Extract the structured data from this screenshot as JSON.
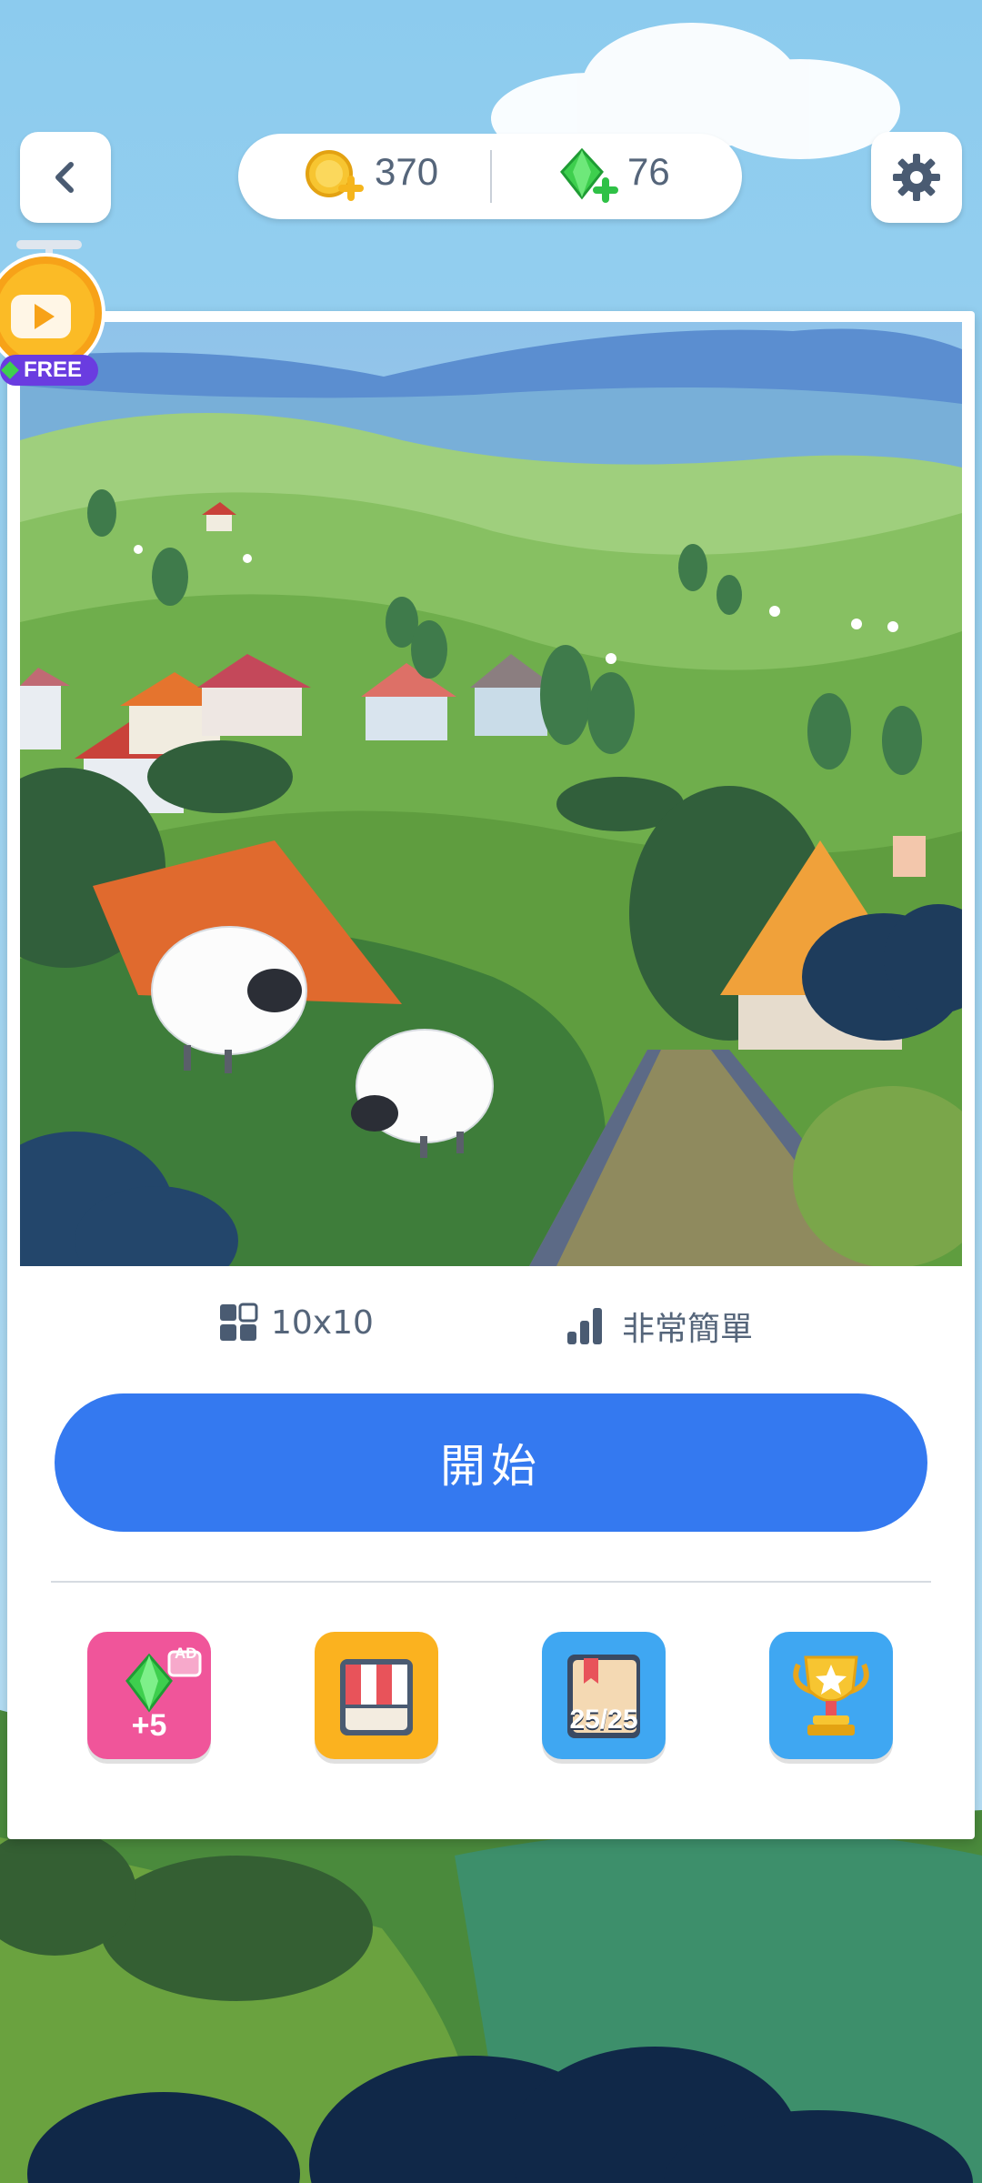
{
  "header": {
    "back_icon": "chevron-left-icon",
    "coins": "370",
    "coin_icon": "gold-coin-plus-icon",
    "gems": "76",
    "gem_icon": "green-gem-plus-icon",
    "settings_icon": "gear-icon"
  },
  "free_reward": {
    "label": "FREE",
    "icon": "video-play-icon"
  },
  "puzzle": {
    "grid_size": "10x10",
    "grid_icon": "grid-icon",
    "difficulty": "非常簡單",
    "difficulty_icon": "signal-bars-icon"
  },
  "start_button": {
    "label": "開始"
  },
  "tiles": [
    {
      "id": "ad-gems",
      "label": "+5",
      "badge": "AD",
      "icon": "gem-ad-icon",
      "color": "#f0559a"
    },
    {
      "id": "shop",
      "label": "",
      "icon": "shop-awning-icon",
      "color": "#fbb21f"
    },
    {
      "id": "collection",
      "label": "25/25",
      "icon": "book-icon",
      "color": "#3fa7f2"
    },
    {
      "id": "achievements",
      "label": "",
      "icon": "trophy-icon",
      "color": "#3fa7f2"
    }
  ],
  "colors": {
    "primary": "#3479f0",
    "sky": "#7fc0e6",
    "grass": "#5d9e45"
  }
}
